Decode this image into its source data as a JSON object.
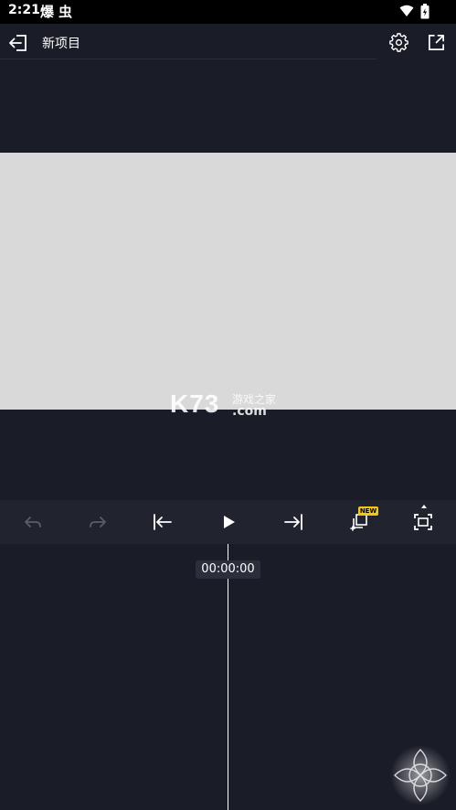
{
  "status_bar": {
    "time": "2:21",
    "glyph1": "爆",
    "glyph2": "虫",
    "wifi_icon": "wifi-icon",
    "battery_icon": "battery-icon"
  },
  "app_bar": {
    "title": "新项目",
    "back_icon": "back-icon",
    "settings_icon": "gear-icon",
    "export_icon": "export-icon"
  },
  "canvas": {
    "background": "#d9d9d9"
  },
  "watermark": {
    "brand": "K73",
    "name": "游戏之家",
    "domain": ".com"
  },
  "toolbar": {
    "items": [
      {
        "icon": "undo-icon",
        "enabled": false
      },
      {
        "icon": "redo-icon",
        "enabled": false
      },
      {
        "icon": "skip-to-start-icon",
        "enabled": true
      },
      {
        "icon": "play-icon",
        "enabled": true
      },
      {
        "icon": "skip-to-end-icon",
        "enabled": true
      },
      {
        "icon": "add-layer-icon",
        "enabled": true
      },
      {
        "icon": "fullscreen-icon",
        "enabled": true
      }
    ],
    "new_badge": "NEW"
  },
  "timeline": {
    "timecode": "00:00:00"
  },
  "colors": {
    "background": "#1a1c27",
    "toolbar": "#21232f",
    "badge": "#f5c518",
    "disabled_icon": "#5a5d69"
  }
}
